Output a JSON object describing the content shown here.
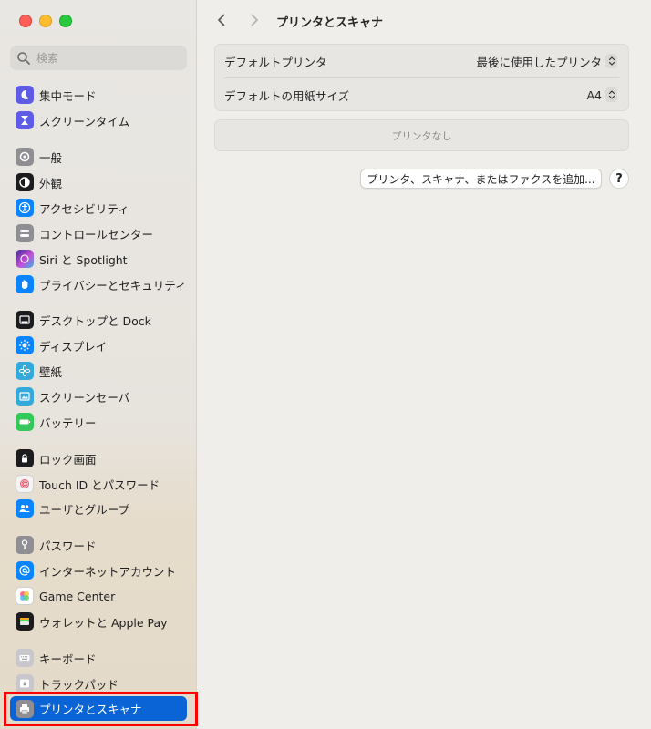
{
  "window": {
    "title": "プリンタとスキャナ"
  },
  "search": {
    "placeholder": "検索"
  },
  "sidebar": {
    "items": [
      {
        "label": "集中モード",
        "icon": "moon-icon",
        "color": "#5e5ce6"
      },
      {
        "label": "スクリーンタイム",
        "icon": "hourglass-icon",
        "color": "#5e5ce6"
      },
      {
        "label": "一般",
        "icon": "gear-icon",
        "color": "#8e8e93"
      },
      {
        "label": "外観",
        "icon": "appearance-icon",
        "color": "#1c1c1e"
      },
      {
        "label": "アクセシビリティ",
        "icon": "accessibility-icon",
        "color": "#0a84ff"
      },
      {
        "label": "コントロールセンター",
        "icon": "control-center-icon",
        "color": "#8e8e93"
      },
      {
        "label": "Siri と Spotlight",
        "icon": "siri-icon",
        "color": "#7d4bd6"
      },
      {
        "label": "プライバシーとセキュリティ",
        "icon": "hand-icon",
        "color": "#0a84ff"
      },
      {
        "label": "デスクトップと Dock",
        "icon": "dock-icon",
        "color": "#1c1c1e"
      },
      {
        "label": "ディスプレイ",
        "icon": "sun-icon",
        "color": "#0a84ff"
      },
      {
        "label": "壁紙",
        "icon": "flower-icon",
        "color": "#34aadc"
      },
      {
        "label": "スクリーンセーバ",
        "icon": "screensaver-icon",
        "color": "#34aadc"
      },
      {
        "label": "バッテリー",
        "icon": "battery-icon",
        "color": "#34c759"
      },
      {
        "label": "ロック画面",
        "icon": "lock-icon",
        "color": "#1c1c1e"
      },
      {
        "label": "Touch ID とパスワード",
        "icon": "fingerprint-icon",
        "color": "#f2f2f2"
      },
      {
        "label": "ユーザとグループ",
        "icon": "users-icon",
        "color": "#0a84ff"
      },
      {
        "label": "パスワード",
        "icon": "key-icon",
        "color": "#8e8e93"
      },
      {
        "label": "インターネットアカウント",
        "icon": "at-icon",
        "color": "#0a84ff"
      },
      {
        "label": "Game Center",
        "icon": "game-center-icon",
        "color": "#ffffff"
      },
      {
        "label": "ウォレットと Apple Pay",
        "icon": "wallet-icon",
        "color": "#1c1c1e"
      },
      {
        "label": "キーボード",
        "icon": "keyboard-icon",
        "color": "#b0b0b5"
      },
      {
        "label": "トラックパッド",
        "icon": "trackpad-icon",
        "color": "#b0b0b5"
      },
      {
        "label": "プリンタとスキャナ",
        "icon": "printer-icon",
        "color": "#8e8e93",
        "selected": true
      }
    ]
  },
  "main": {
    "settings": [
      {
        "label": "デフォルトプリンタ",
        "value": "最後に使用したプリンタ"
      },
      {
        "label": "デフォルトの用紙サイズ",
        "value": "A4"
      }
    ],
    "empty_text": "プリンタなし",
    "add_button": "プリンタ、スキャナ、またはファクスを追加...",
    "help_button": "?"
  },
  "colors": {
    "accent": "#0a64d6",
    "highlight": "#ff0000"
  }
}
